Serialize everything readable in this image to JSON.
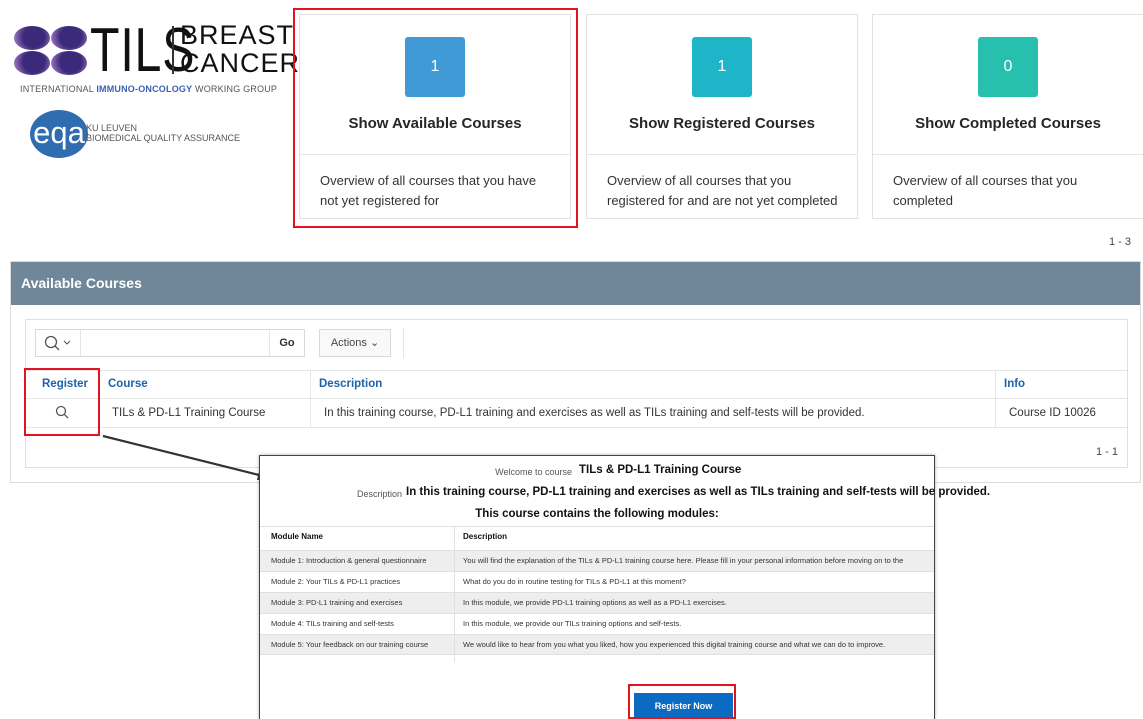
{
  "logos": {
    "tils": {
      "word": "TILS",
      "line1": "BREAST",
      "line2": "CANCER",
      "subtitle_pre": "INTERNATIONAL ",
      "subtitle_highlight": "IMMUNO-ONCOLOGY",
      "subtitle_post": " WORKING GROUP"
    },
    "eqa": {
      "mark": "eqa",
      "line1": "KU LEUVEN",
      "line2": "BIOMEDICAL QUALITY ASSURANCE"
    }
  },
  "cards": [
    {
      "count": "1",
      "title": "Show Available Courses",
      "desc": "Overview of all courses that you have not yet registered for",
      "color": "#3f9ad6"
    },
    {
      "count": "1",
      "title": "Show Registered Courses",
      "desc": "Overview of all courses that you registered for and are not yet completed",
      "color": "#1eb5c9"
    },
    {
      "count": "0",
      "title": "Show Completed Courses",
      "desc": "Overview of all courses that you completed",
      "color": "#27bfae"
    }
  ],
  "cards_pagination": "1 - 3",
  "region": {
    "title": "Available Courses",
    "go_label": "Go",
    "actions_label": "Actions",
    "columns": [
      "Register",
      "Course",
      "Description",
      "Info"
    ],
    "rows": [
      {
        "course": "TILs & PD-L1 Training Course",
        "description": "In this training course, PD-L1 training and exercises as well as TILs training and self-tests will be provided.",
        "info": "Course ID 10026"
      }
    ],
    "pagination": "1 - 1"
  },
  "modal": {
    "welcome_label": "Welcome to course",
    "welcome_value": "TILs & PD-L1 Training Course",
    "desc_label": "Description",
    "desc_value": "In this training course, PD-L1 training and exercises as well as TILs training and self-tests will be provided.",
    "modules_title": "This course contains the following modules:",
    "columns": [
      "Module Name",
      "Description"
    ],
    "modules": [
      {
        "name": "Module 1: Introduction & general questionnaire",
        "desc": "You will find the explanation of the TILs & PD-L1 training course here. Please fill in your personal information before moving on to the"
      },
      {
        "name": "Module 2: Your TILs & PD-L1 practices",
        "desc": "What do you do in routine testing for TILs & PD-L1 at this moment?"
      },
      {
        "name": "Module 3: PD-L1 training and exercises",
        "desc": "In this module, we provide PD-L1 training options as well as a PD-L1 exercises."
      },
      {
        "name": "Module 4: TILs training and self-tests",
        "desc": "In this module, we provide our TILs training options and self-tests."
      },
      {
        "name": "Module 5: Your feedback on our training course",
        "desc": "We would like to hear from you what you liked, how you experienced this digital training course and what we can do to improve."
      }
    ],
    "register_label": "Register Now"
  },
  "colors": {
    "highlight": "#e0141e",
    "region_header": "#6f8798",
    "link": "#1f62a8",
    "primary": "#0b6bc3"
  }
}
